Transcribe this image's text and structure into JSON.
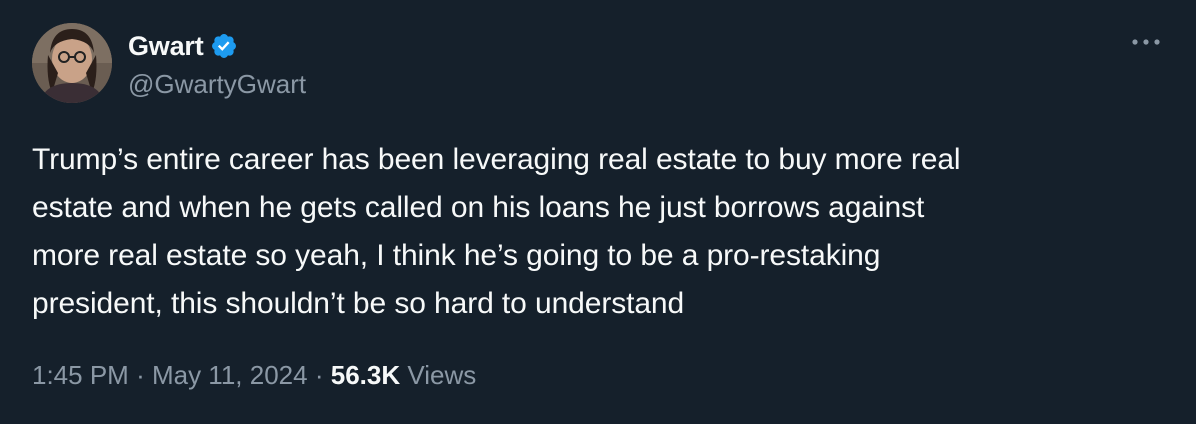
{
  "author": {
    "display_name": "Gwart",
    "handle": "@GwartyGwart",
    "verified_icon": "verified-badge-icon",
    "verified_color": "#1d9bf0"
  },
  "tweet": {
    "text": "Trump’s entire career has been leveraging real estate to buy more real\nestate and when he gets called on his loans he just borrows against\nmore real estate so yeah, I think he’s going to be a pro-restaking\npresident, this shouldn’t be so hard to understand"
  },
  "meta": {
    "time": "1:45 PM",
    "separator": "·",
    "date": "May 11, 2024",
    "views_count": "56.3K",
    "views_label": "Views"
  },
  "colors": {
    "background": "#15202b",
    "primary_text": "#f7f9f9",
    "secondary_text": "#8b98a5"
  },
  "more_icon": "more-options-icon"
}
